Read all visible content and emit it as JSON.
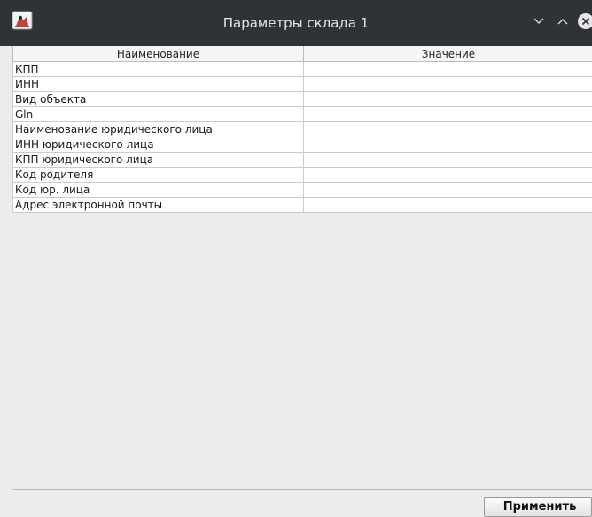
{
  "window": {
    "title": "Параметры склада 1",
    "icon": "java-duke-icon",
    "buttons": [
      "minimize-icon",
      "maximize-icon",
      "close-icon"
    ]
  },
  "table": {
    "columns": [
      "Наименование",
      "Значение"
    ],
    "rows": [
      {
        "name": "КПП",
        "value": ""
      },
      {
        "name": "ИНН",
        "value": ""
      },
      {
        "name": "Вид объекта",
        "value": ""
      },
      {
        "name": "Gln",
        "value": ""
      },
      {
        "name": "Наименование юридического лица",
        "value": ""
      },
      {
        "name": "ИНН юридического лица",
        "value": ""
      },
      {
        "name": "КПП юридического лица",
        "value": ""
      },
      {
        "name": "Код родителя",
        "value": ""
      },
      {
        "name": "Код юр. лица",
        "value": ""
      },
      {
        "name": "Адрес электронной почты",
        "value": ""
      }
    ]
  },
  "footer": {
    "apply_label": "Применить"
  },
  "colors": {
    "titlebar": "#2f3337",
    "background": "#ececec",
    "cell_border": "#c7cbd4",
    "close_button": "#e6e6e6"
  }
}
